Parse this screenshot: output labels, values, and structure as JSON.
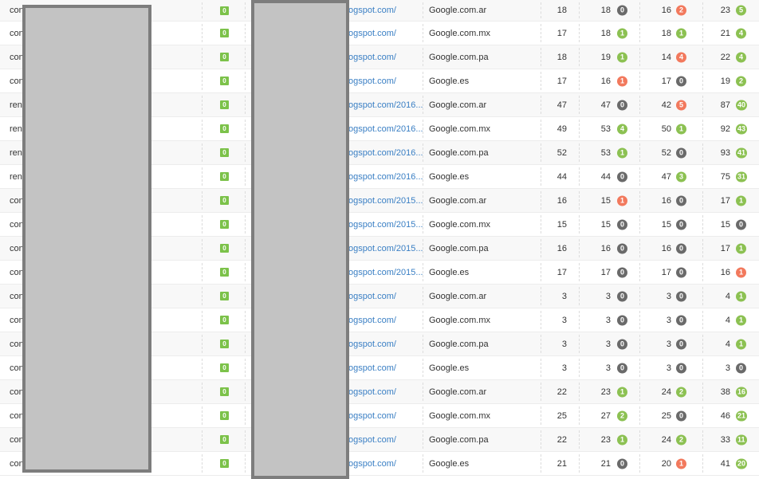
{
  "rows": [
    {
      "kw": "con",
      "flag": "0",
      "url": "ogspot.com/",
      "engine": "Google.com.ar",
      "c1": "18",
      "c2": "18",
      "b2": "0",
      "b2c": "gray",
      "c3": "16",
      "b3": "2",
      "b3c": "red",
      "c4": "23",
      "b4": "5",
      "b4c": "green"
    },
    {
      "kw": "con",
      "flag": "0",
      "url": "ogspot.com/",
      "engine": "Google.com.mx",
      "c1": "17",
      "c2": "18",
      "b2": "1",
      "b2c": "green",
      "c3": "18",
      "b3": "1",
      "b3c": "green",
      "c4": "21",
      "b4": "4",
      "b4c": "green"
    },
    {
      "kw": "con",
      "flag": "0",
      "url": "ogspot.com/",
      "engine": "Google.com.pa",
      "c1": "18",
      "c2": "19",
      "b2": "1",
      "b2c": "green",
      "c3": "14",
      "b3": "4",
      "b3c": "red",
      "c4": "22",
      "b4": "4",
      "b4c": "green"
    },
    {
      "kw": "con",
      "flag": "0",
      "url": "ogspot.com/",
      "engine": "Google.es",
      "c1": "17",
      "c2": "16",
      "b2": "1",
      "b2c": "red",
      "c3": "17",
      "b3": "0",
      "b3c": "gray",
      "c4": "19",
      "b4": "2",
      "b4c": "green"
    },
    {
      "kw": "ren",
      "flag": "0",
      "url": "ogspot.com/2016...",
      "engine": "Google.com.ar",
      "c1": "47",
      "c2": "47",
      "b2": "0",
      "b2c": "gray",
      "c3": "42",
      "b3": "5",
      "b3c": "red",
      "c4": "87",
      "b4": "40",
      "b4c": "green"
    },
    {
      "kw": "ren",
      "flag": "0",
      "url": "ogspot.com/2016...",
      "engine": "Google.com.mx",
      "c1": "49",
      "c2": "53",
      "b2": "4",
      "b2c": "green",
      "c3": "50",
      "b3": "1",
      "b3c": "green",
      "c4": "92",
      "b4": "43",
      "b4c": "green"
    },
    {
      "kw": "ren",
      "flag": "0",
      "url": "ogspot.com/2016...",
      "engine": "Google.com.pa",
      "c1": "52",
      "c2": "53",
      "b2": "1",
      "b2c": "green",
      "c3": "52",
      "b3": "0",
      "b3c": "gray",
      "c4": "93",
      "b4": "41",
      "b4c": "green"
    },
    {
      "kw": "ren",
      "flag": "0",
      "url": "ogspot.com/2016...",
      "engine": "Google.es",
      "c1": "44",
      "c2": "44",
      "b2": "0",
      "b2c": "gray",
      "c3": "47",
      "b3": "3",
      "b3c": "green",
      "c4": "75",
      "b4": "31",
      "b4c": "green"
    },
    {
      "kw": "con",
      "flag": "0",
      "url": "ogspot.com/2015...",
      "engine": "Google.com.ar",
      "c1": "16",
      "c2": "15",
      "b2": "1",
      "b2c": "red",
      "c3": "16",
      "b3": "0",
      "b3c": "gray",
      "c4": "17",
      "b4": "1",
      "b4c": "green"
    },
    {
      "kw": "con",
      "flag": "0",
      "url": "ogspot.com/2015...",
      "engine": "Google.com.mx",
      "c1": "15",
      "c2": "15",
      "b2": "0",
      "b2c": "gray",
      "c3": "15",
      "b3": "0",
      "b3c": "gray",
      "c4": "15",
      "b4": "0",
      "b4c": "gray"
    },
    {
      "kw": "con",
      "flag": "0",
      "url": "ogspot.com/2015...",
      "engine": "Google.com.pa",
      "c1": "16",
      "c2": "16",
      "b2": "0",
      "b2c": "gray",
      "c3": "16",
      "b3": "0",
      "b3c": "gray",
      "c4": "17",
      "b4": "1",
      "b4c": "green"
    },
    {
      "kw": "con",
      "flag": "0",
      "url": "ogspot.com/2015...",
      "engine": "Google.es",
      "c1": "17",
      "c2": "17",
      "b2": "0",
      "b2c": "gray",
      "c3": "17",
      "b3": "0",
      "b3c": "gray",
      "c4": "16",
      "b4": "1",
      "b4c": "red"
    },
    {
      "kw": "con",
      "flag": "0",
      "url": "ogspot.com/",
      "engine": "Google.com.ar",
      "c1": "3",
      "c2": "3",
      "b2": "0",
      "b2c": "gray",
      "c3": "3",
      "b3": "0",
      "b3c": "gray",
      "c4": "4",
      "b4": "1",
      "b4c": "green"
    },
    {
      "kw": "con",
      "flag": "0",
      "url": "ogspot.com/",
      "engine": "Google.com.mx",
      "c1": "3",
      "c2": "3",
      "b2": "0",
      "b2c": "gray",
      "c3": "3",
      "b3": "0",
      "b3c": "gray",
      "c4": "4",
      "b4": "1",
      "b4c": "green"
    },
    {
      "kw": "con",
      "flag": "0",
      "url": "ogspot.com/",
      "engine": "Google.com.pa",
      "c1": "3",
      "c2": "3",
      "b2": "0",
      "b2c": "gray",
      "c3": "3",
      "b3": "0",
      "b3c": "gray",
      "c4": "4",
      "b4": "1",
      "b4c": "green"
    },
    {
      "kw": "con",
      "flag": "0",
      "url": "ogspot.com/",
      "engine": "Google.es",
      "c1": "3",
      "c2": "3",
      "b2": "0",
      "b2c": "gray",
      "c3": "3",
      "b3": "0",
      "b3c": "gray",
      "c4": "3",
      "b4": "0",
      "b4c": "gray"
    },
    {
      "kw": "con",
      "flag": "0",
      "url": "ogspot.com/",
      "engine": "Google.com.ar",
      "c1": "22",
      "c2": "23",
      "b2": "1",
      "b2c": "green",
      "c3": "24",
      "b3": "2",
      "b3c": "green",
      "c4": "38",
      "b4": "16",
      "b4c": "green"
    },
    {
      "kw": "con",
      "flag": "0",
      "url": "ogspot.com/",
      "engine": "Google.com.mx",
      "c1": "25",
      "c2": "27",
      "b2": "2",
      "b2c": "green",
      "c3": "25",
      "b3": "0",
      "b3c": "gray",
      "c4": "46",
      "b4": "21",
      "b4c": "green"
    },
    {
      "kw": "con",
      "flag": "0",
      "url": "ogspot.com/",
      "engine": "Google.com.pa",
      "c1": "22",
      "c2": "23",
      "b2": "1",
      "b2c": "green",
      "c3": "24",
      "b3": "2",
      "b3c": "green",
      "c4": "33",
      "b4": "11",
      "b4c": "green"
    },
    {
      "kw": "con",
      "flag": "0",
      "url": "ogspot.com/",
      "engine": "Google.es",
      "c1": "21",
      "c2": "21",
      "b2": "0",
      "b2c": "gray",
      "c3": "20",
      "b3": "1",
      "b3c": "red",
      "c4": "41",
      "b4": "20",
      "b4c": "green"
    }
  ],
  "colors": {
    "gray": "#6a6a6a",
    "green": "#8cc152",
    "red": "#f2795d",
    "link": "#3a7fc4"
  }
}
